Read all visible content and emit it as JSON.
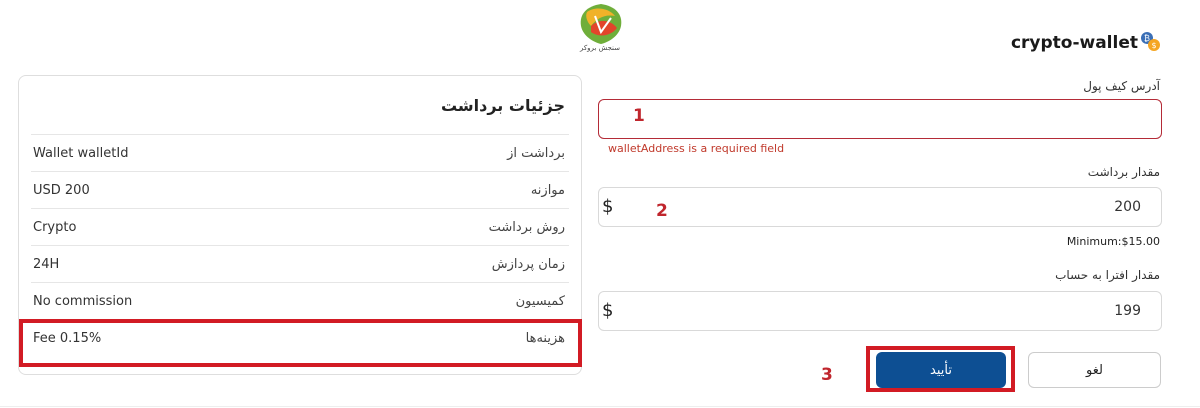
{
  "logo": {
    "caption": "سنجش بروکر"
  },
  "header": {
    "title": "crypto-wallet",
    "icon": "wallet-coins-icon"
  },
  "form": {
    "wallet_address": {
      "label": "آدرس کیف پول",
      "value": "",
      "error": "walletAddress is a required field"
    },
    "withdraw_amount": {
      "label": "مقدار برداشت",
      "value": "200",
      "currency_symbol": "$",
      "minimum": "Minimum:$15.00"
    },
    "credit_amount": {
      "label": "مقدار افترا به حساب",
      "value": "199",
      "currency_symbol": "$"
    },
    "buttons": {
      "cancel": "لغو",
      "confirm": "تأیید"
    }
  },
  "annotations": {
    "one": "1",
    "two": "2",
    "three": "3"
  },
  "details": {
    "title": "جزئیات برداشت",
    "rows": [
      {
        "label": "برداشت از",
        "value": "Wallet walletId"
      },
      {
        "label": "موازنه",
        "value": "USD 200"
      },
      {
        "label": "روش برداشت",
        "value": "Crypto"
      },
      {
        "label": "زمان پردازش",
        "value": "24H"
      },
      {
        "label": "کمیسیون",
        "value": "No commission"
      },
      {
        "label": "هزینه‌ها",
        "value": "Fee 0.15%"
      }
    ]
  },
  "colors": {
    "primary_button": "#0d4f93",
    "error": "#b42b37",
    "annotation": "#d21b24"
  }
}
